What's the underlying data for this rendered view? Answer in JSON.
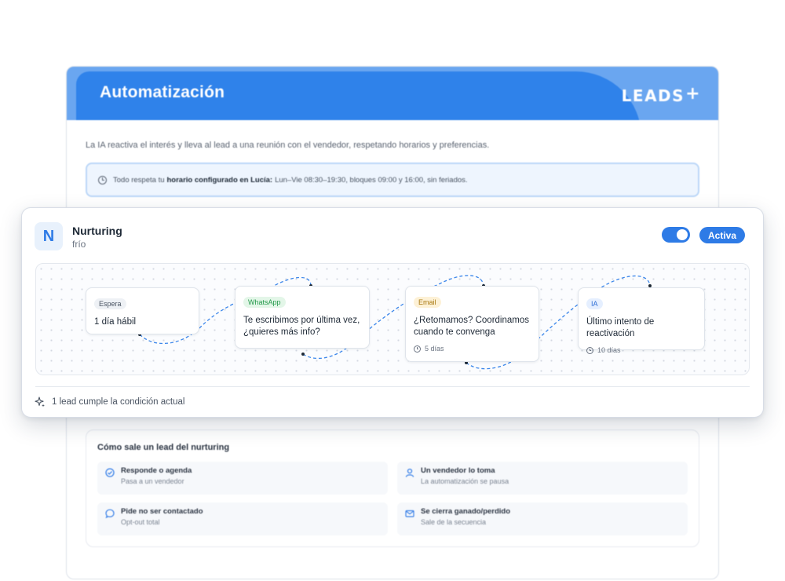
{
  "window": {
    "title": "Automatización",
    "logo_text": "LEADS",
    "logo_plus": "+",
    "description": "La IA reactiva el interés y lleva al lead a una reunión con el vendedor, respetando horarios y preferencias.",
    "notice": {
      "prefix": "Todo respeta tu",
      "bold": "horario configurado en Lucía:",
      "suffix": "Lun–Vie 08:30–19:30, bloques 09:00 y 16:00, sin feriados."
    }
  },
  "sequence": {
    "initial": "N",
    "name": "Nurturing",
    "segment": "frío",
    "status_label": "Activa",
    "enabled": true,
    "steps": [
      {
        "tag": "Espera",
        "text": "1 día hábil",
        "meta": ""
      },
      {
        "tag": "WhatsApp",
        "text": "Te escribimos por última vez, ¿quieres más info?",
        "meta": ""
      },
      {
        "tag": "Email",
        "text": "¿Retomamos? Coordinamos cuando te convenga",
        "meta": "5 días"
      },
      {
        "tag": "IA",
        "text": "Último intento de reactivación",
        "meta": "10 días"
      }
    ],
    "footer": "1 lead cumple la condición actual"
  },
  "exit": {
    "title": "Cómo sale un lead del nurturing",
    "items": [
      {
        "icon": "check-circle-icon",
        "title": "Responde o agenda",
        "subtitle": "Pasa a un vendedor"
      },
      {
        "icon": "user-icon",
        "title": "Un vendedor lo toma",
        "subtitle": "La automatización se pausa"
      },
      {
        "icon": "chat-bubble-icon",
        "title": "Pide no ser contactado",
        "subtitle": "Opt-out total"
      },
      {
        "icon": "mail-icon",
        "title": "Se cierra ganado/perdido",
        "subtitle": "Sale de la secuencia"
      }
    ]
  },
  "colors": {
    "primary": "#2e7be6",
    "header_light": "#6aa6f0",
    "whatsapp": "#23994a",
    "email": "#a8770e"
  }
}
